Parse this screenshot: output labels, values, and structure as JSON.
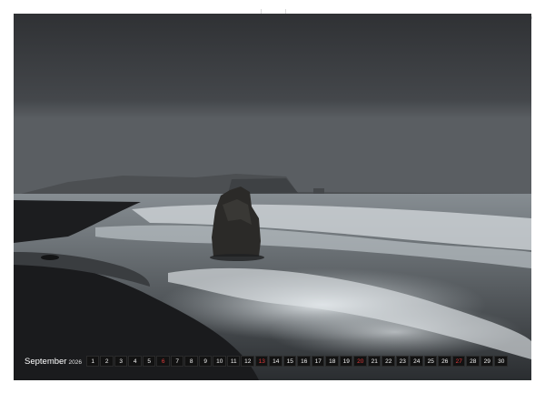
{
  "calendar": {
    "month": "September",
    "year": "2026",
    "days": [
      "1",
      "2",
      "3",
      "4",
      "5",
      "6",
      "7",
      "8",
      "9",
      "10",
      "11",
      "12",
      "13",
      "14",
      "15",
      "16",
      "17",
      "18",
      "19",
      "20",
      "21",
      "22",
      "23",
      "24",
      "25",
      "26",
      "27",
      "28",
      "29",
      "30"
    ],
    "sundays": [
      "6",
      "13",
      "20",
      "27"
    ]
  },
  "colors": {
    "sky": "#3b3d40",
    "sea": "#7b8286",
    "sand": "#1e1f21",
    "sunday": "#e23b3b"
  },
  "icons": {
    "binding": "spiral-binding",
    "hanger": "hanger-hole"
  }
}
